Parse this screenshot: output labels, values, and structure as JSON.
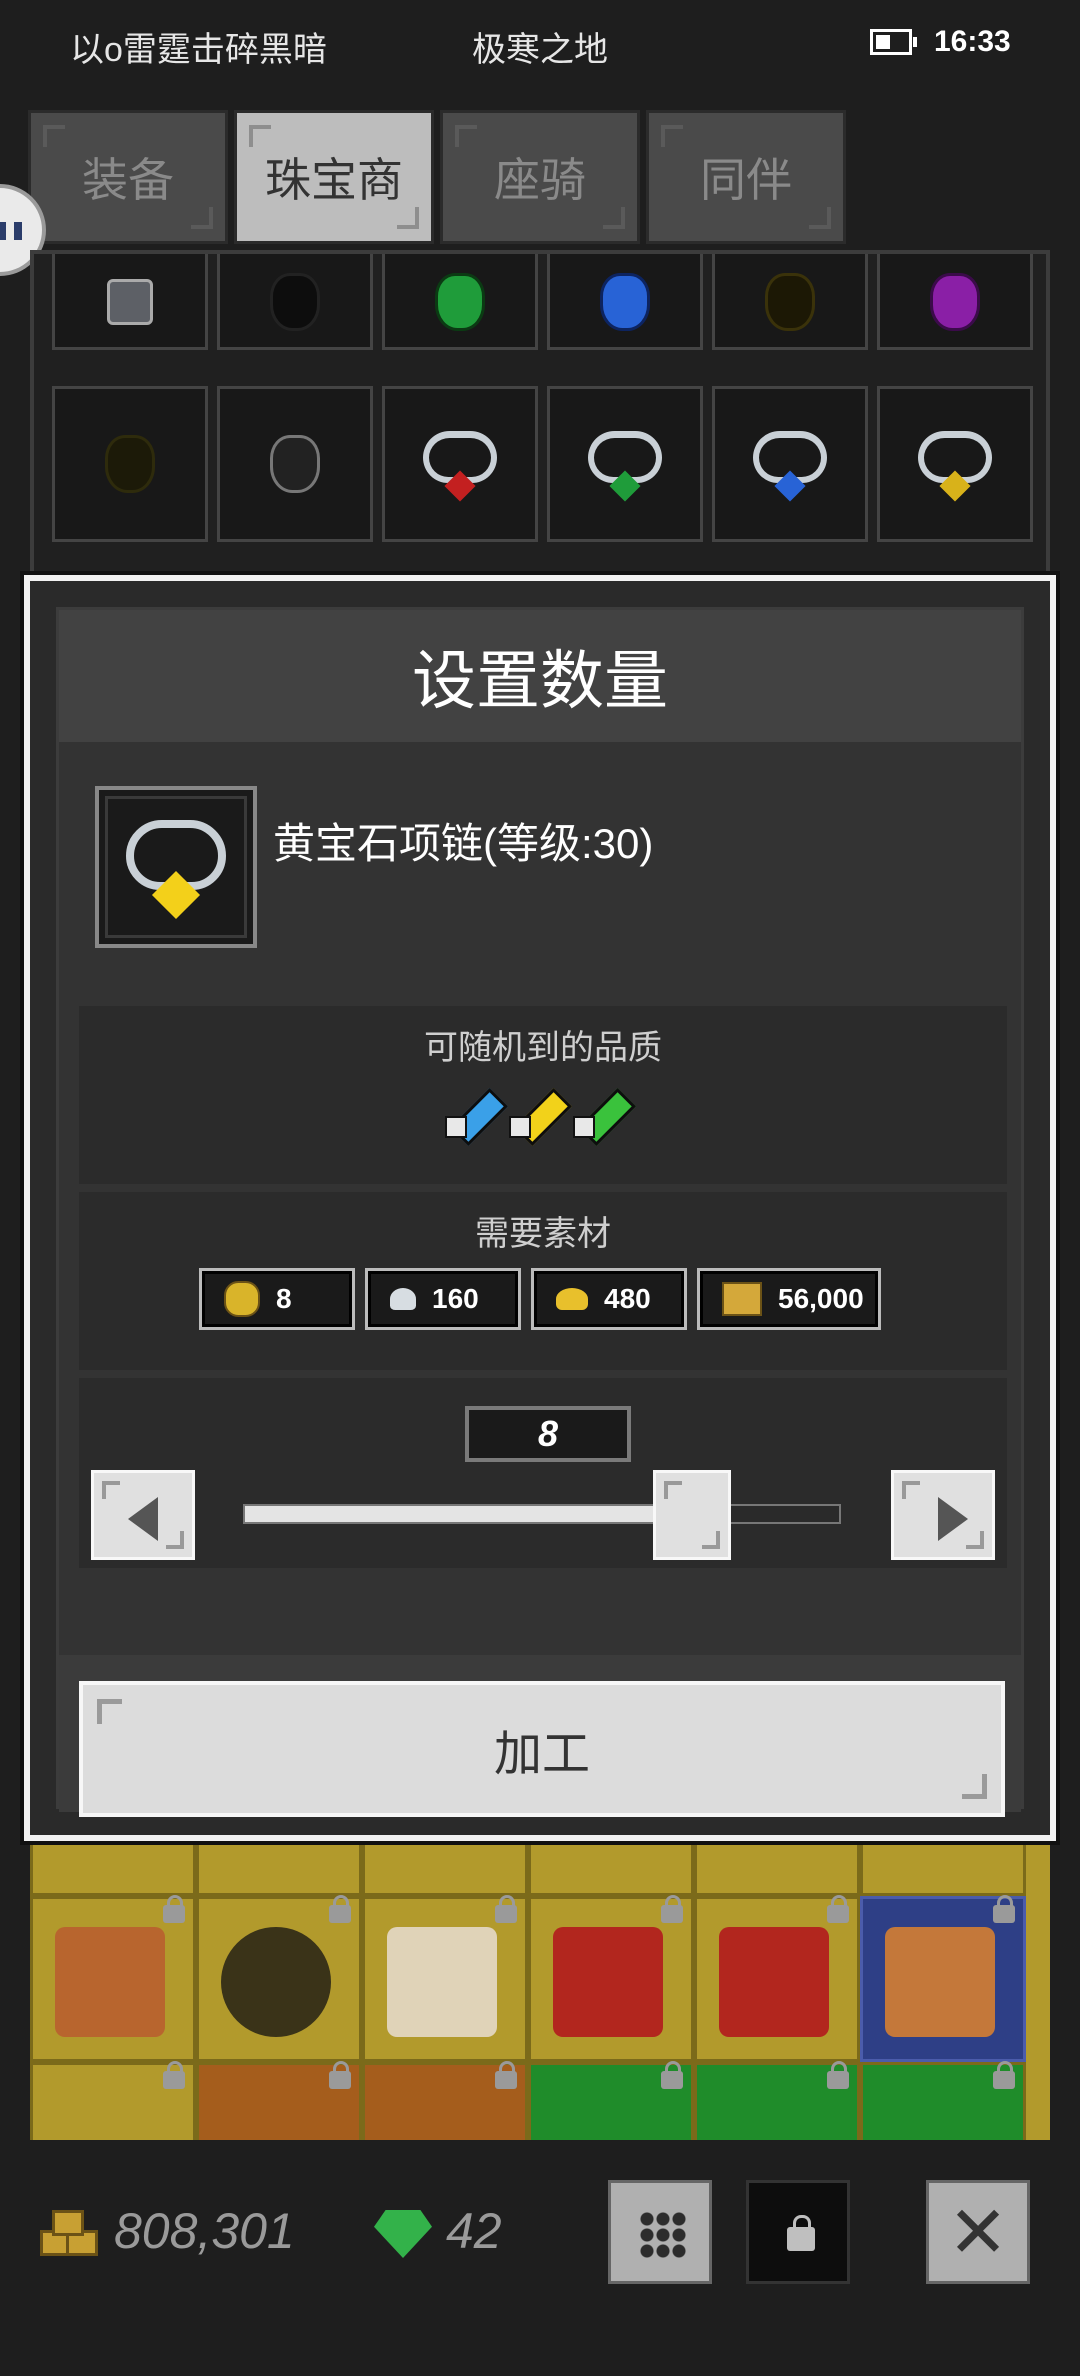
{
  "status_bar": {
    "left_text": "以o雷霆击碎黑暗",
    "center_text": "极寒之地",
    "time": "16:33"
  },
  "tabs": [
    {
      "label": "装备",
      "active": false
    },
    {
      "label": "珠宝商",
      "active": true
    },
    {
      "label": "座骑",
      "active": false
    },
    {
      "label": "同伴",
      "active": false
    }
  ],
  "dialog": {
    "title": "设置数量",
    "item_name": "黄宝石项链(等级:30)",
    "quality_label": "可随机到的品质",
    "qualities": [
      {
        "icon": "blue-sword-icon",
        "color": "#3aa0e8"
      },
      {
        "icon": "yellow-sword-icon",
        "color": "#f2d21a"
      },
      {
        "icon": "green-sword-icon",
        "color": "#3ac23c"
      }
    ],
    "materials_label": "需要素材",
    "materials": [
      {
        "icon": "topaz-gem-icon",
        "value": "8",
        "color": "#d9b42a"
      },
      {
        "icon": "silver-ore-icon",
        "value": "160",
        "color": "#d7dde2"
      },
      {
        "icon": "gold-pile-icon",
        "value": "480",
        "color": "#e8c02c"
      },
      {
        "icon": "gold-bars-icon",
        "value": "56,000",
        "color": "#d4a83a"
      }
    ],
    "quantity": "8",
    "slider_fraction": 0.75,
    "process_label": "加工"
  },
  "footer": {
    "gold": "808,301",
    "gems": "42"
  },
  "colors": {
    "background": "#1e1e1e",
    "dialog_border": "#f2f2f2",
    "inventory_yellow": "#b29a2c"
  }
}
